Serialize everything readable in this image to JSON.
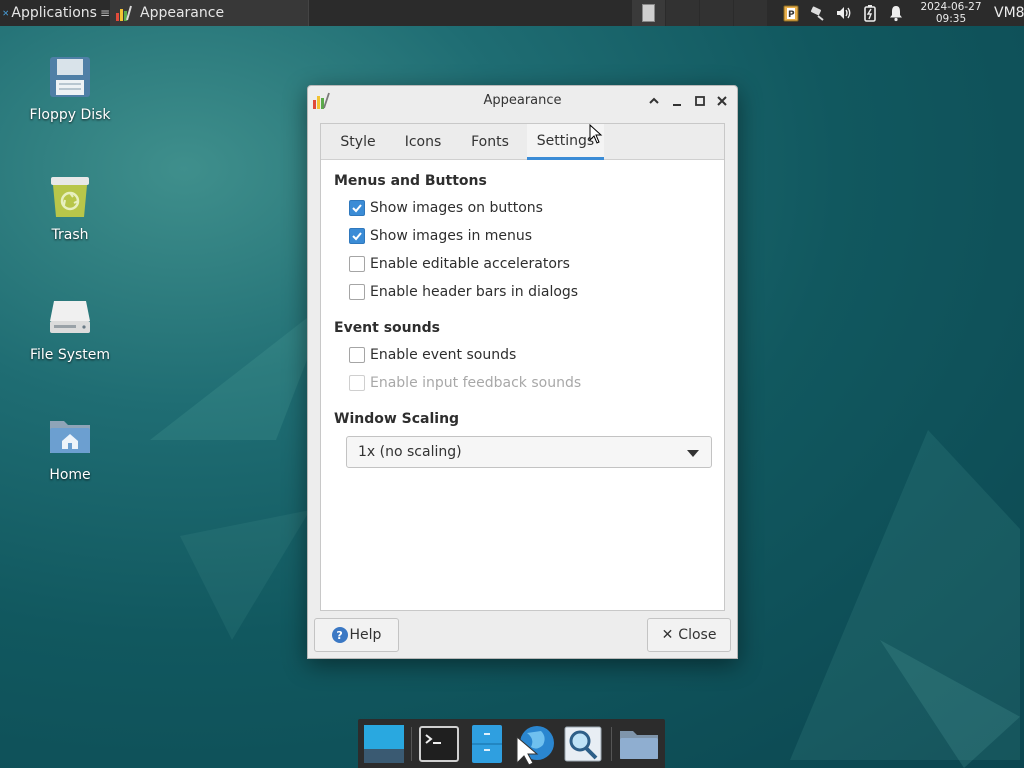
{
  "panel": {
    "applications_label": "Applications",
    "active_window_title": "Appearance",
    "clock_date": "2024-06-27",
    "clock_time": "09:35",
    "host_label": "VM8"
  },
  "desktop": {
    "icons": [
      {
        "label": "Floppy Disk",
        "icon": "floppy-disk-icon"
      },
      {
        "label": "Trash",
        "icon": "trash-icon"
      },
      {
        "label": "File System",
        "icon": "hard-drive-icon"
      },
      {
        "label": "Home",
        "icon": "home-folder-icon"
      }
    ]
  },
  "dialog": {
    "title": "Appearance",
    "tabs": [
      {
        "label": "Style"
      },
      {
        "label": "Icons"
      },
      {
        "label": "Fonts"
      },
      {
        "label": "Settings",
        "active": true
      }
    ],
    "sections": {
      "menus_buttons": {
        "heading": "Menus and Buttons",
        "options": [
          {
            "label": "Show images on buttons",
            "checked": true
          },
          {
            "label": "Show images in menus",
            "checked": true
          },
          {
            "label": "Enable editable accelerators",
            "checked": false
          },
          {
            "label": "Enable header bars in dialogs",
            "checked": false
          }
        ]
      },
      "event_sounds": {
        "heading": "Event sounds",
        "options": [
          {
            "label": "Enable event sounds",
            "checked": false
          },
          {
            "label": "Enable input feedback sounds",
            "checked": false,
            "disabled": true
          }
        ]
      },
      "window_scaling": {
        "heading": "Window Scaling",
        "selected": "1x (no scaling)"
      }
    },
    "help_label": "Help",
    "close_label": "Close"
  },
  "colors": {
    "accent": "#3b8cd6",
    "panel_bg": "#2b2b2b",
    "desktop_bg": "#11585f"
  }
}
